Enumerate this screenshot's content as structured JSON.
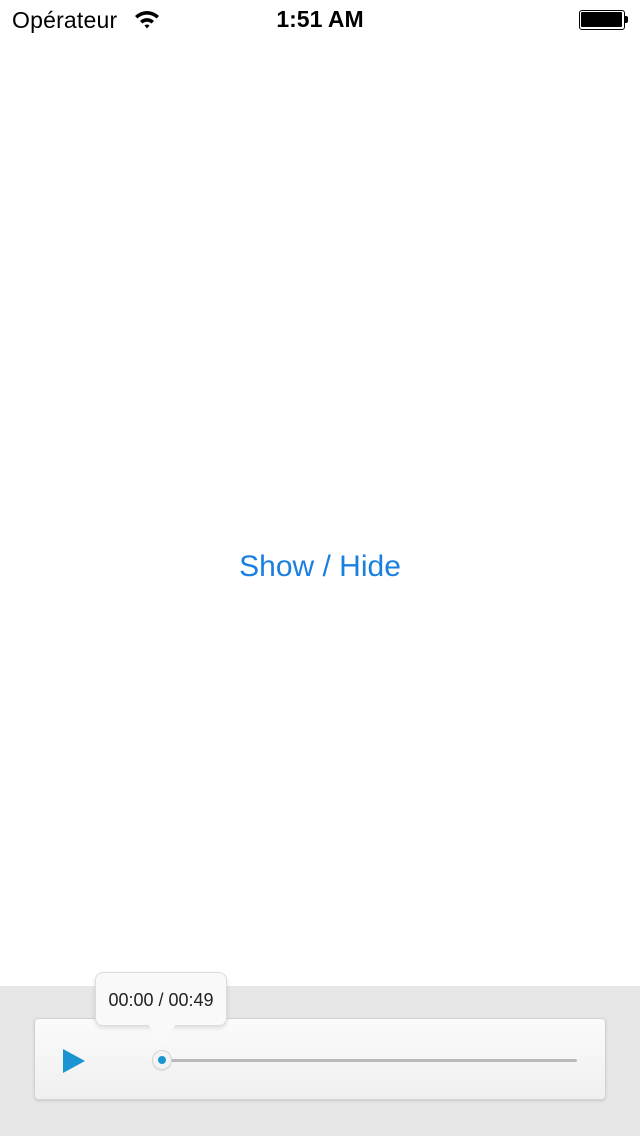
{
  "status_bar": {
    "carrier": "Opérateur",
    "time": "1:51 AM",
    "wifi_icon": "wifi-icon",
    "battery_icon": "battery-full-icon"
  },
  "main": {
    "toggle_label": "Show / Hide"
  },
  "player": {
    "time_display": "00:00 / 00:49",
    "play_icon": "play-icon",
    "progress": 0.0,
    "accent_color": "#1a95d2"
  },
  "colors": {
    "link": "#1a7fe0",
    "bottom_background": "#e6e6e6"
  }
}
